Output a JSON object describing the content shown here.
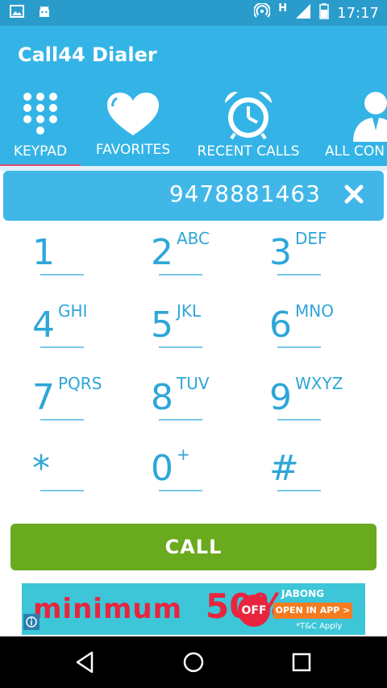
{
  "status_bar": {
    "time": "17:17",
    "network": "H"
  },
  "app_title": "Call44 Dialer",
  "tabs": [
    {
      "label": "KEYPAD",
      "icon": "keypad-icon",
      "selected": true
    },
    {
      "label": "FAVORITES",
      "icon": "heart-icon"
    },
    {
      "label": "RECENT CALLS",
      "icon": "alarm-clock-icon"
    },
    {
      "label": "ALL CON",
      "icon": "contact-person-icon"
    }
  ],
  "dial_number": "9478881463",
  "keys": [
    {
      "digit": "1",
      "letters": ""
    },
    {
      "digit": "2",
      "letters": "ABC"
    },
    {
      "digit": "3",
      "letters": "DEF"
    },
    {
      "digit": "4",
      "letters": "GHI"
    },
    {
      "digit": "5",
      "letters": "JKL"
    },
    {
      "digit": "6",
      "letters": "MNO"
    },
    {
      "digit": "7",
      "letters": "PQRS"
    },
    {
      "digit": "8",
      "letters": "TUV"
    },
    {
      "digit": "9",
      "letters": "WXYZ"
    },
    {
      "digit": "*",
      "letters": ""
    },
    {
      "digit": "0",
      "letters": "+"
    },
    {
      "digit": "#",
      "letters": ""
    }
  ],
  "call_label": "CALL",
  "ad": {
    "headline": "minimum",
    "percent": "50%",
    "off": "OFF",
    "brand": "JABONG",
    "cta": "OPEN IN APP >",
    "terms": "*T&C Apply"
  },
  "colors": {
    "header": "#34b4e6",
    "status_bar": "#2a9ccc",
    "accent": "#2ea6d8",
    "call_button": "#6aaa1e",
    "tab_indicator": "#e84a6a"
  }
}
